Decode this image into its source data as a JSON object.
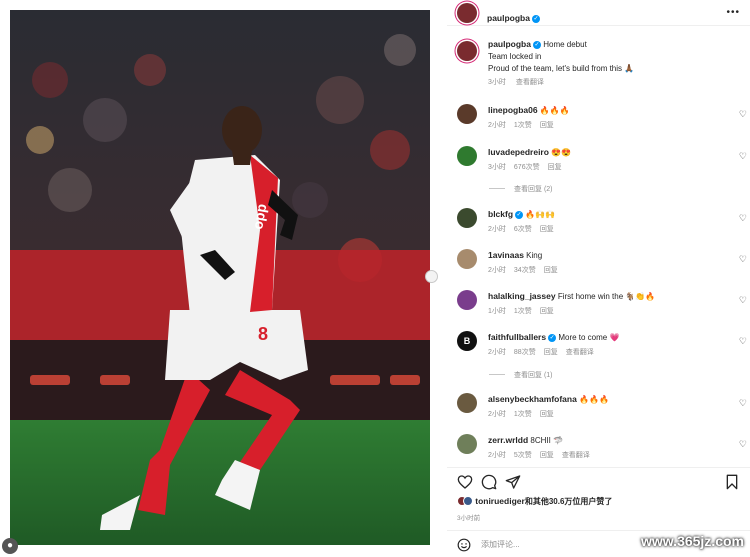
{
  "post": {
    "username": "paulpogba",
    "caption_lines": [
      "Home debut",
      "Team locked in",
      "Proud of the team, let's build from this 🙏🏾"
    ],
    "time": "3小时",
    "translate": "查看翻译"
  },
  "comments": [
    {
      "user": "linepogba06",
      "text": "🔥🔥🔥",
      "time": "2小时",
      "likes": "1次赞",
      "reply": "回复",
      "avatar_color": "#5a3a2a"
    },
    {
      "user": "luvadepedreiro",
      "text": "😍😍",
      "time": "3小时",
      "likes": "676次赞",
      "reply": "回复",
      "avatar_color": "#2f7a2f",
      "thread": "查看回复 (2)"
    },
    {
      "user": "blckfg",
      "verified": true,
      "text": "🔥🙌🙌",
      "time": "2小时",
      "likes": "6次赞",
      "reply": "回复",
      "avatar_color": "#3b4a2e"
    },
    {
      "user": "1avinaas",
      "text": "King",
      "time": "2小时",
      "likes": "34次赞",
      "reply": "回复",
      "avatar_color": "#a78b6d"
    },
    {
      "user": "halalking_jassey",
      "text": "First home win the 🐐👏🔥",
      "time": "1小时",
      "likes": "1次赞",
      "reply": "回复",
      "avatar_color": "#7a3d8c"
    },
    {
      "user": "faithfullballers",
      "verified": true,
      "text": "More to come 💗",
      "time": "2小时",
      "likes": "88次赞",
      "reply": "回复",
      "translate": "查看翻译",
      "avatar_color": "#111111",
      "thread": "查看回复 (1)"
    },
    {
      "user": "alsenybeckhamfofana",
      "text": "🔥🔥🔥",
      "time": "2小时",
      "likes": "1次赞",
      "reply": "回复",
      "avatar_color": "#6a5a40"
    },
    {
      "user": "zerr.wrldd",
      "text": "8CHII 🦈",
      "time": "2小时",
      "likes": "5次赞",
      "reply": "回复",
      "translate": "查看翻译",
      "avatar_color": "#6f7f5a"
    }
  ],
  "likes_text": {
    "user": "toniruediger",
    "rest": "和其他30.6万位用户赞了"
  },
  "time_bottom": "3小时前",
  "add_comment": {
    "placeholder": "添加评论..."
  },
  "watermark": "www.365jz.com",
  "colors": {
    "story_ring": "#d62976",
    "verified": "#0095f6",
    "jersey_red": "#d71f2b"
  }
}
